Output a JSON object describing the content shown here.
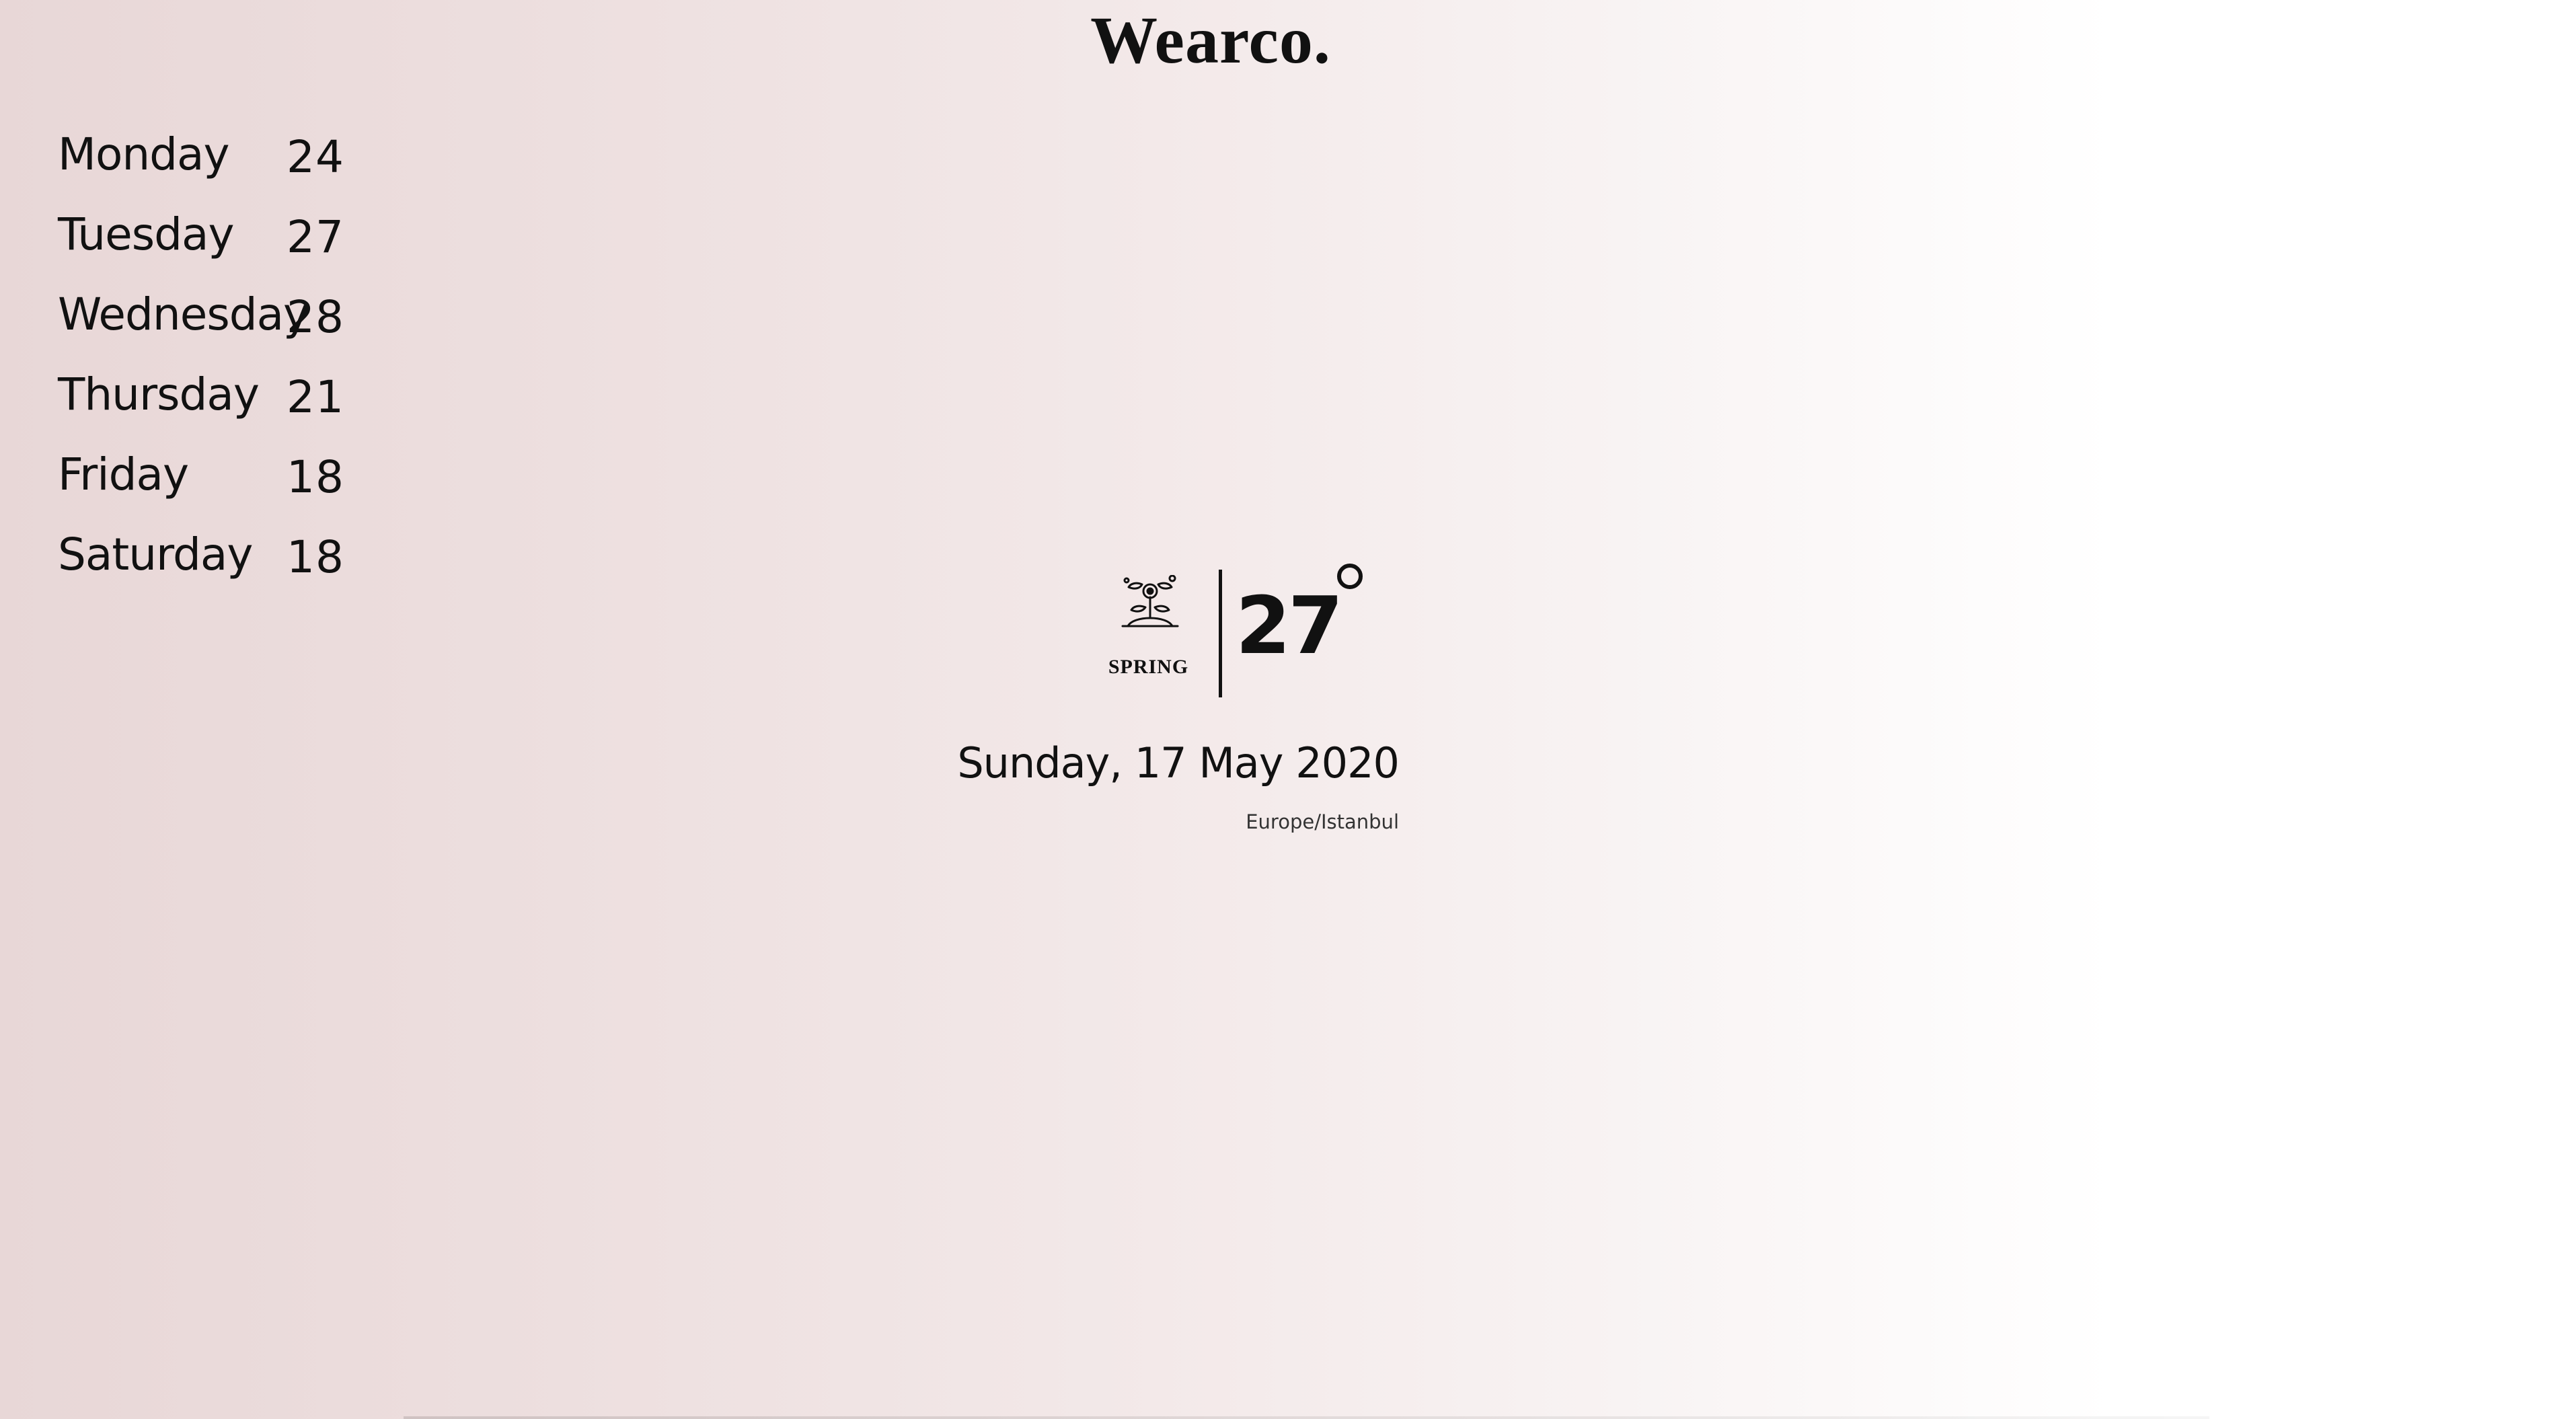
{
  "app": {
    "brand": "Wearco."
  },
  "forecast": [
    {
      "day": "Monday",
      "temp": "24"
    },
    {
      "day": "Tuesday",
      "temp": "27"
    },
    {
      "day": "Wednesday",
      "temp": "28"
    },
    {
      "day": "Thursday",
      "temp": "21"
    },
    {
      "day": "Friday",
      "temp": "18"
    },
    {
      "day": "Saturday",
      "temp": "18"
    }
  ],
  "current": {
    "season_label": "SPRING",
    "season_icon": "spring-plant-icon",
    "temperature": "27",
    "degree_icon": "degree-icon",
    "date": "Sunday, 17 May 2020",
    "timezone": "Europe/Istanbul"
  },
  "colors": {
    "background_left": "#e8d7d7",
    "background_right": "#ffffff",
    "text": "#111111"
  }
}
